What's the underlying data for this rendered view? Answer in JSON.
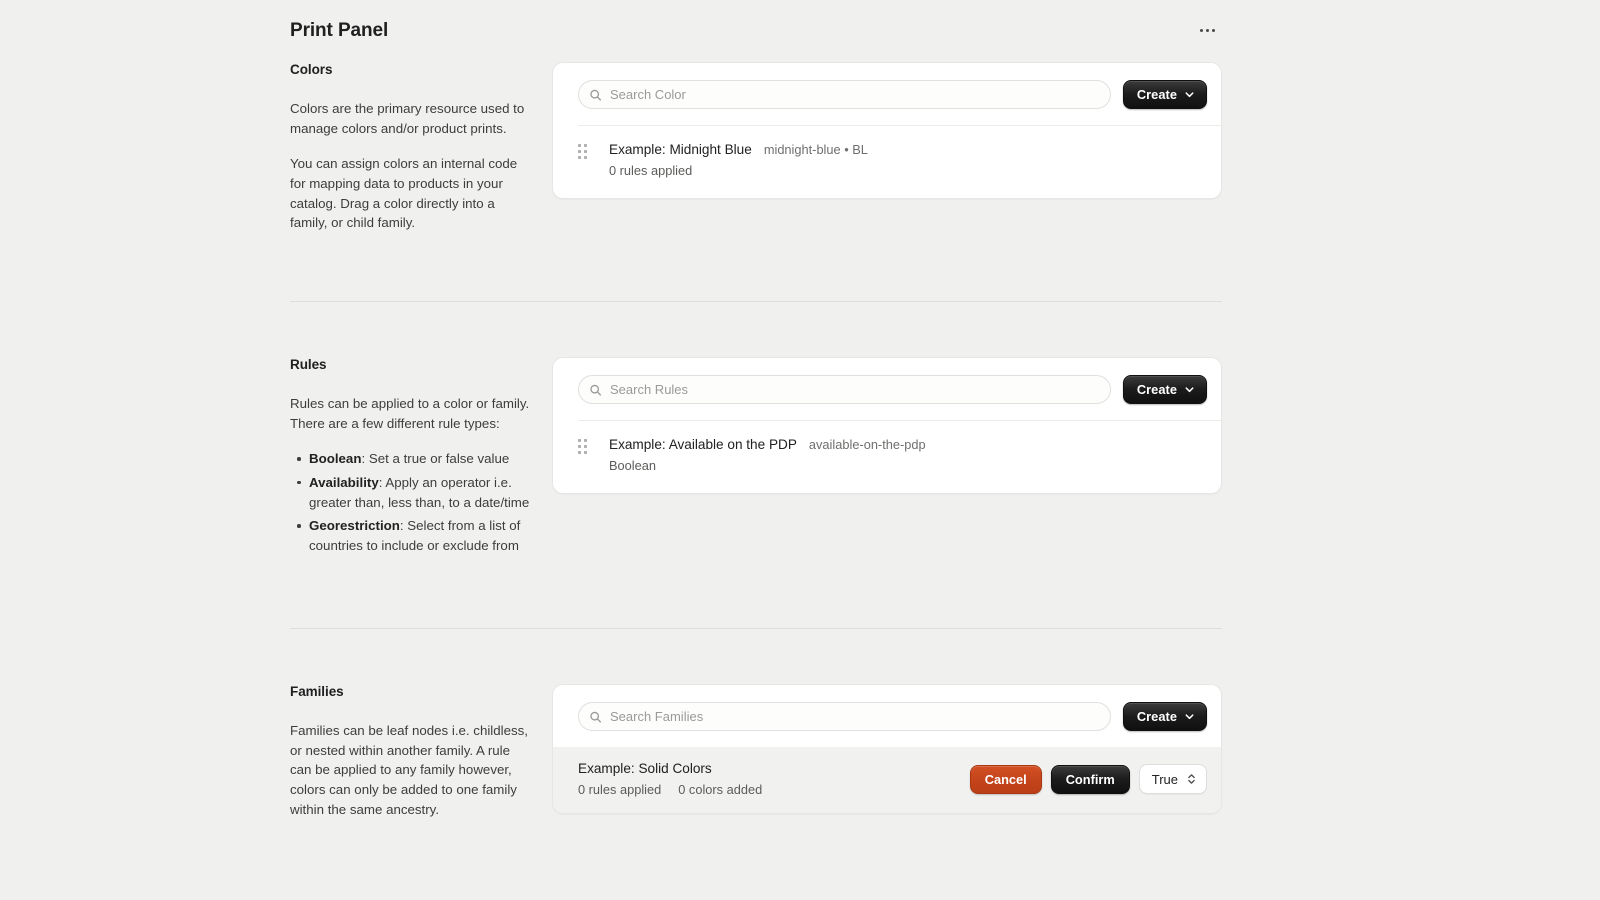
{
  "header": {
    "title": "Print Panel",
    "menu_icon": "kebab-menu-icon"
  },
  "sections": [
    {
      "id": "colors",
      "title": "Colors",
      "paragraphs": [
        "Colors are the primary resource used to manage colors and/or product prints.",
        "You can assign colors an internal code for mapping data to products in your catalog. Drag a color directly into a family, or child family."
      ],
      "search_placeholder": "Search Color",
      "search_value": "",
      "create_label": "Create",
      "rows": [
        {
          "name": "Example: Midnight Blue",
          "slug": "midnight-blue • BL",
          "meta1": "0 rules applied"
        }
      ]
    },
    {
      "id": "rules",
      "title": "Rules",
      "paragraphs": [
        "Rules can be applied to a color or family. There are a few different rule types:"
      ],
      "bullets": [
        {
          "term": "Boolean",
          "rest": ": Set a true or false value"
        },
        {
          "term": "Availability",
          "rest": ": Apply an operator i.e. greater than, less than, to a date/time"
        },
        {
          "term": "Georestriction",
          "rest": ": Select from a list of countries to include or exclude from"
        }
      ],
      "search_placeholder": "Search Rules",
      "search_value": "",
      "create_label": "Create",
      "rows": [
        {
          "name": "Example: Available on the PDP",
          "slug": "available-on-the-pdp",
          "meta1": "Boolean"
        }
      ]
    },
    {
      "id": "families",
      "title": "Families",
      "paragraphs": [
        "Families can be leaf nodes i.e. childless, or nested within another family. A rule can be applied to any family however, colors can only be added to one family within the same ancestry."
      ],
      "search_placeholder": "Search Families",
      "search_value": "",
      "create_label": "Create",
      "rows": [
        {
          "name": "Example: Solid Colors",
          "meta1": "0 rules applied",
          "meta2": "0 colors added",
          "cancel_label": "Cancel",
          "confirm_label": "Confirm",
          "select_value": "True"
        }
      ]
    }
  ],
  "colors": {
    "page_background": "#f0f0ef",
    "card_background": "#ffffff",
    "accent_dark": "#151515",
    "accent_danger": "#c4431a",
    "row_highlight": "#f1f1f0"
  }
}
